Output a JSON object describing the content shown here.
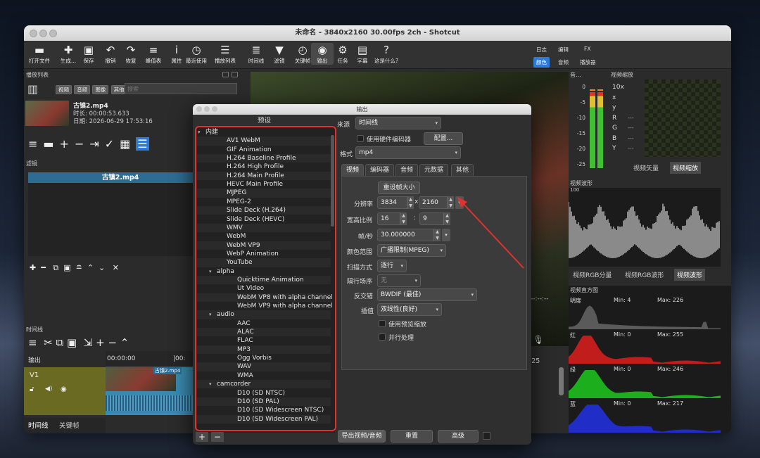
{
  "window": {
    "title": "未命名 - 3840x2160 30.00fps 2ch - Shotcut"
  },
  "toolbar": {
    "items": [
      {
        "label": "打开文件",
        "icon": "folder-icon",
        "glyph": "▬"
      },
      {
        "label": "生成...",
        "icon": "new-file-icon",
        "glyph": "✚"
      },
      {
        "label": "保存",
        "icon": "save-icon",
        "glyph": "▣"
      },
      {
        "label": "撤销",
        "icon": "undo-icon",
        "glyph": "↶"
      },
      {
        "label": "恢复",
        "icon": "redo-icon",
        "glyph": "↷"
      },
      {
        "label": "峰值表",
        "icon": "peak-meter-icon",
        "glyph": "≡"
      },
      {
        "label": "属性",
        "icon": "info-icon",
        "glyph": "i"
      },
      {
        "label": "最近使用",
        "icon": "clock-icon",
        "glyph": "◷"
      },
      {
        "label": "播放列表",
        "icon": "list-icon",
        "glyph": "☰"
      },
      {
        "label": "时间线",
        "icon": "timeline-icon",
        "glyph": "≣"
      },
      {
        "label": "滤镜",
        "icon": "filter-icon",
        "glyph": "▼"
      },
      {
        "label": "关键帧",
        "icon": "stopwatch-icon",
        "glyph": "◴"
      },
      {
        "label": "输出",
        "icon": "export-disc-icon",
        "glyph": "◉"
      },
      {
        "label": "任务",
        "icon": "gear-icon",
        "glyph": "⚙"
      },
      {
        "label": "字幕",
        "icon": "subtitle-icon",
        "glyph": "▤"
      },
      {
        "label": "这是什么?",
        "icon": "help-icon",
        "glyph": "?"
      }
    ],
    "layouts": {
      "top": [
        "日志",
        "编辑",
        "FX"
      ],
      "bottom": [
        "颜色",
        "音频",
        "播放器"
      ],
      "selected": "颜色"
    }
  },
  "playlist": {
    "header": "播放列表",
    "filters": [
      "视频",
      "音频",
      "图像",
      "其他"
    ],
    "search_placeholder": "搜索",
    "item": {
      "name": "古镇2.mp4",
      "duration": "时长: 00:00:53.633",
      "date": "日期:  2026-06-29 17:53:16"
    }
  },
  "filters_panel": {
    "header": "滤镜",
    "clip": "古镇2.mp4"
  },
  "timeline": {
    "header": "时间线",
    "output_label": "输出",
    "track": "V1",
    "tc0": "00:00:00",
    "tc1": "|00:",
    "tc_right": ":25",
    "clip": "古镇2.mp4",
    "tabs": [
      "时间线",
      "关键帧"
    ]
  },
  "player": {
    "timecode": "--:--:--"
  },
  "meters": {
    "header_audio": "音...",
    "header_zoom": "视频缩放",
    "db": [
      "0",
      "-5",
      "-10",
      "-15",
      "-20",
      "-25"
    ],
    "zoom_readouts": [
      "10x",
      "x",
      "y",
      "R",
      "G",
      "B",
      "Y"
    ],
    "dashes": "---",
    "tabs": [
      "视频矢量",
      "视频缩放"
    ],
    "selected_tab": "视频缩放"
  },
  "waveform": {
    "header": "视频波形",
    "scale": "100",
    "tabs": [
      "视频RGB分量",
      "视频RGB波形",
      "视频波形"
    ],
    "selected_tab": "视频波形"
  },
  "histogram": {
    "header": "视频直方图",
    "rows": [
      {
        "name": "明度",
        "min": "Min: 4",
        "max": "Max: 226",
        "color": "#d0d0d0"
      },
      {
        "name": "红",
        "min": "Min: 0",
        "max": "Max: 255",
        "color": "#e01e1e"
      },
      {
        "name": "绿",
        "min": "Min: 0",
        "max": "Max: 246",
        "color": "#1ec81e"
      },
      {
        "name": "蓝",
        "min": "Min: 0",
        "max": "Max: 217",
        "color": "#2232e6"
      }
    ]
  },
  "export": {
    "title": "输出",
    "presets_header": "预设",
    "search_placeholder": "搜索",
    "presets": [
      {
        "t": "内建",
        "lvl": 0,
        "arrow": "▾"
      },
      {
        "t": "AV1 WebM",
        "lvl": 1
      },
      {
        "t": "GIF Animation",
        "lvl": 1
      },
      {
        "t": "H.264 Baseline Profile",
        "lvl": 1
      },
      {
        "t": "H.264 High Profile",
        "lvl": 1
      },
      {
        "t": "H.264 Main Profile",
        "lvl": 1
      },
      {
        "t": "HEVC Main Profile",
        "lvl": 1
      },
      {
        "t": "MJPEG",
        "lvl": 1
      },
      {
        "t": "MPEG-2",
        "lvl": 1
      },
      {
        "t": "Slide Deck (H.264)",
        "lvl": 1
      },
      {
        "t": "Slide Deck (HEVC)",
        "lvl": 1
      },
      {
        "t": "WMV",
        "lvl": 1
      },
      {
        "t": "WebM",
        "lvl": 1
      },
      {
        "t": "WebM VP9",
        "lvl": 1
      },
      {
        "t": "WebP Animation",
        "lvl": 1
      },
      {
        "t": "YouTube",
        "lvl": 1
      },
      {
        "t": "alpha",
        "lvl": 1,
        "arrow": "▾"
      },
      {
        "t": "Quicktime Animation",
        "lvl": 2
      },
      {
        "t": "Ut Video",
        "lvl": 2
      },
      {
        "t": "WebM VP8 with alpha channel",
        "lvl": 2
      },
      {
        "t": "WebM VP9 with alpha channel",
        "lvl": 2
      },
      {
        "t": "audio",
        "lvl": 1,
        "arrow": "▾"
      },
      {
        "t": "AAC",
        "lvl": 2
      },
      {
        "t": "ALAC",
        "lvl": 2
      },
      {
        "t": "FLAC",
        "lvl": 2
      },
      {
        "t": "MP3",
        "lvl": 2
      },
      {
        "t": "Ogg Vorbis",
        "lvl": 2
      },
      {
        "t": "WAV",
        "lvl": 2
      },
      {
        "t": "WMA",
        "lvl": 2
      },
      {
        "t": "camcorder",
        "lvl": 1,
        "arrow": "▾"
      },
      {
        "t": "D10 (SD NTSC)",
        "lvl": 2
      },
      {
        "t": "D10 (SD PAL)",
        "lvl": 2
      },
      {
        "t": "D10 (SD Widescreen NTSC)",
        "lvl": 2
      },
      {
        "t": "D10 (SD Widescreen PAL)",
        "lvl": 2
      }
    ],
    "source_label": "来源",
    "source_value": "时间线",
    "hw_label": "使用硬件编码器",
    "config_btn": "配置...",
    "format_label": "格式",
    "format_value": "mp4",
    "tabs": [
      "视频",
      "编码器",
      "音频",
      "元数据",
      "其他"
    ],
    "selected_tab": "视频",
    "reset_size": "重设帧大小",
    "resolution_label": "分辨率",
    "width": "3834",
    "x_sep": "x",
    "height": "2160",
    "aspect_label": "宽高比例",
    "aspect_w": "16",
    "colon": ":",
    "aspect_h": "9",
    "fps_label": "帧/秒",
    "fps": "30.000000",
    "color_range_label": "颜色范围",
    "color_range": "广播限制(MPEG)",
    "scan_label": "扫描方式",
    "scan": "逐行",
    "field_order_label": "隔行场序",
    "field_order": "无",
    "deinterlace_label": "反交错",
    "deinterlace": "BWDIF (最佳)",
    "interp_label": "插值",
    "interp": "双线性(良好)",
    "preview_scale": "使用预览缩放",
    "parallel": "并行处理",
    "export_btn": "导出视频/音频",
    "reset_btn": "重置",
    "advanced_btn": "高级"
  },
  "annotation_color": "#e0332f"
}
